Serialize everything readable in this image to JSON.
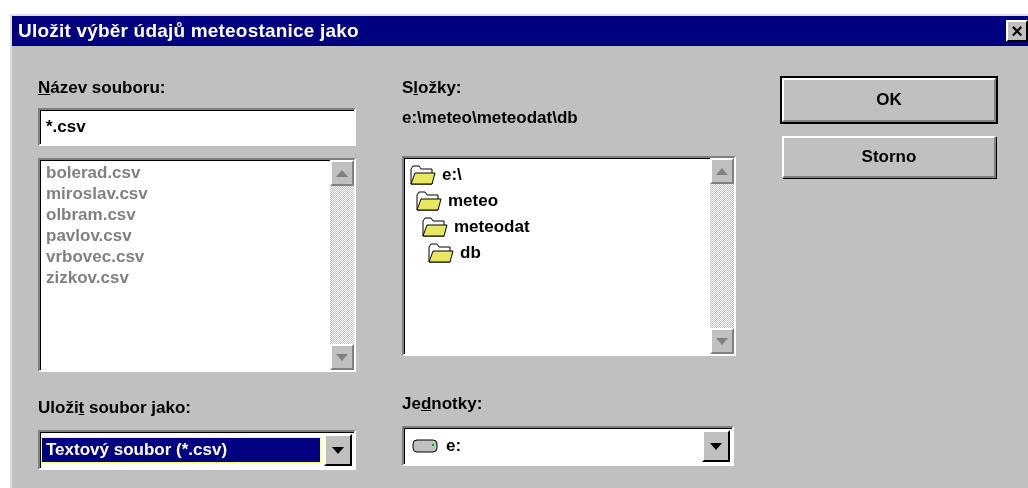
{
  "window": {
    "title": "Uložit výběr údajů meteostanice jako",
    "close": "×"
  },
  "file_name": {
    "label": {
      "key": "N",
      "after": "ázev souboru:"
    },
    "value": "*.csv"
  },
  "files": [
    {
      "name": "bolerad.csv",
      "disabled": true
    },
    {
      "name": "miroslav.csv",
      "disabled": true
    },
    {
      "name": "olbram.csv",
      "disabled": true
    },
    {
      "name": "pavlov.csv",
      "disabled": true
    },
    {
      "name": "vrbovec.csv",
      "disabled": true
    },
    {
      "name": "zizkov.csv",
      "disabled": true
    }
  ],
  "folders": {
    "label": {
      "before": "S",
      "key": "l",
      "after": "ožky:"
    },
    "path": "e:\\meteo\\meteodat\\db",
    "tree": [
      {
        "name": "e:\\",
        "children": [
          {
            "name": "meteo",
            "children": [
              {
                "name": "meteodat",
                "children": [
                  {
                    "name": "db"
                  }
                ]
              }
            ]
          }
        ]
      }
    ]
  },
  "save_as": {
    "label": {
      "before": "Uloži",
      "key": "t",
      "after": " soubor jako:"
    },
    "value": "Textový soubor (*.csv)",
    "focused": true
  },
  "drives": {
    "label": {
      "before": "Je",
      "key": "d",
      "after": "notky:"
    },
    "value": "e:"
  },
  "buttons": [
    {
      "label": "OK",
      "default": true
    },
    {
      "label": "Storno",
      "default": false
    }
  ]
}
